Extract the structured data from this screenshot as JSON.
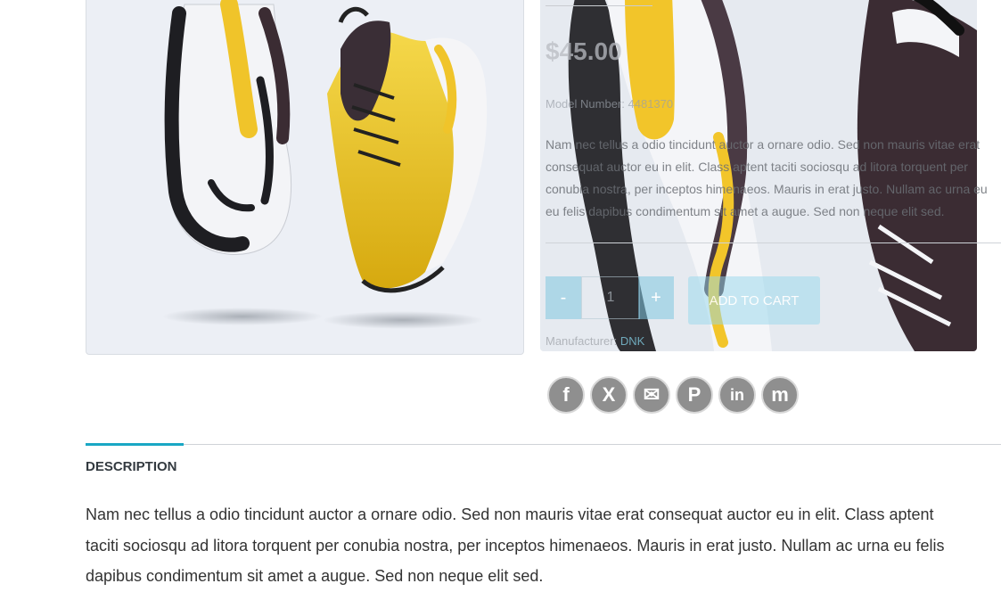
{
  "product": {
    "price": "$45.00",
    "model_label": "Model Number:",
    "model_value": "4481370",
    "short_description_lines": [
      "Nam nec tellus a odio tincidunt auctor a ornare odio. Sed non mauris vitae erat",
      "consequat auctor eu in elit. Class aptent taciti sociosqu ad litora torquent per",
      "conubia nostra, per inceptos himenaeos. Mauris in erat justo. Nullam ac urna eu",
      "eu felis dapibus condimentum sit amet a augue. Sed non neque elit sed."
    ],
    "quantity": "1",
    "qty_minus": "-",
    "qty_plus": "+",
    "add_to_cart": "ADD TO CART",
    "manufacturer_label": "Manufacturer:",
    "manufacturer_value": "DNK"
  },
  "social": [
    {
      "name": "facebook-icon",
      "glyph": "f"
    },
    {
      "name": "x-twitter-icon",
      "glyph": "X"
    },
    {
      "name": "email-icon",
      "glyph": "✉"
    },
    {
      "name": "pinterest-icon",
      "glyph": "P"
    },
    {
      "name": "linkedin-icon",
      "glyph": "in"
    },
    {
      "name": "myspace-icon",
      "glyph": "m"
    }
  ],
  "tabs": {
    "active_label": "DESCRIPTION"
  },
  "description_lines": [
    "Nam nec tellus a odio tincidunt auctor a ornare odio. Sed non mauris vitae erat consequat auctor eu in elit. Class aptent",
    "taciti sociosqu ad litora torquent per conubia nostra, per inceptos himenaeos. Mauris in erat justo. Nullam ac urna eu felis",
    "dapibus condimentum sit amet a augue. Sed non neque elit sed."
  ],
  "colors": {
    "accent": "#19a7c4",
    "shoe_yellow": "#f1c31b",
    "shoe_dark": "#3b2c33"
  }
}
